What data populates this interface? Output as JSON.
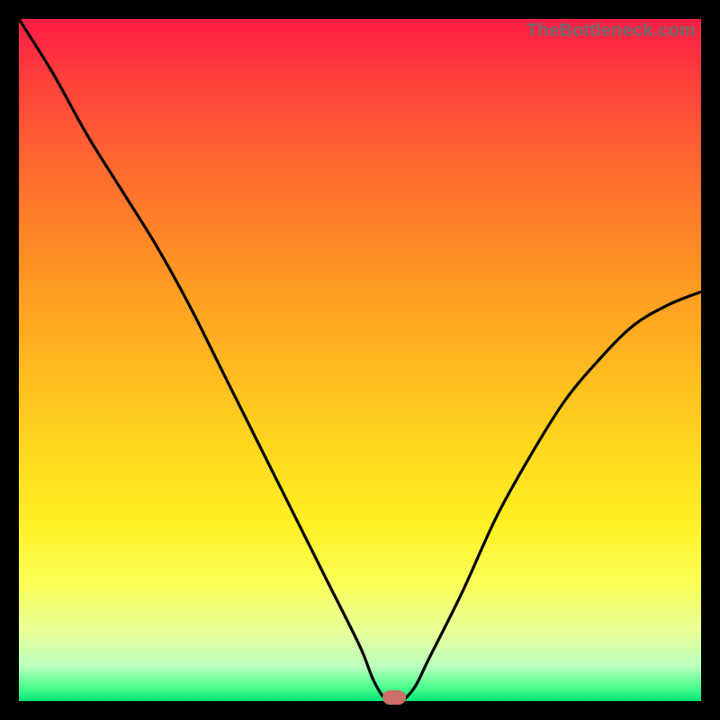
{
  "watermark": "TheBottleneck.com",
  "colors": {
    "frame": "#000000",
    "curve": "#000000",
    "marker": "#cc6f67",
    "gradient_top": "#ff1b44",
    "gradient_bottom": "#00e57a"
  },
  "chart_data": {
    "type": "line",
    "title": "",
    "xlabel": "",
    "ylabel": "",
    "xlim": [
      0,
      100
    ],
    "ylim": [
      0,
      100
    ],
    "series": [
      {
        "name": "bottleneck-curve",
        "x": [
          0,
          5,
          10,
          15,
          20,
          25,
          30,
          35,
          40,
          45,
          50,
          52,
          54,
          56,
          58,
          60,
          65,
          70,
          75,
          80,
          85,
          90,
          95,
          100
        ],
        "y": [
          100,
          92,
          83,
          75,
          67,
          58,
          48,
          38,
          28,
          18,
          8,
          3,
          0,
          0,
          2,
          6,
          16,
          27,
          36,
          44,
          50,
          55,
          58,
          60
        ]
      }
    ],
    "annotations": [
      {
        "name": "optimal-marker",
        "x": 55,
        "y": 0
      }
    ]
  }
}
